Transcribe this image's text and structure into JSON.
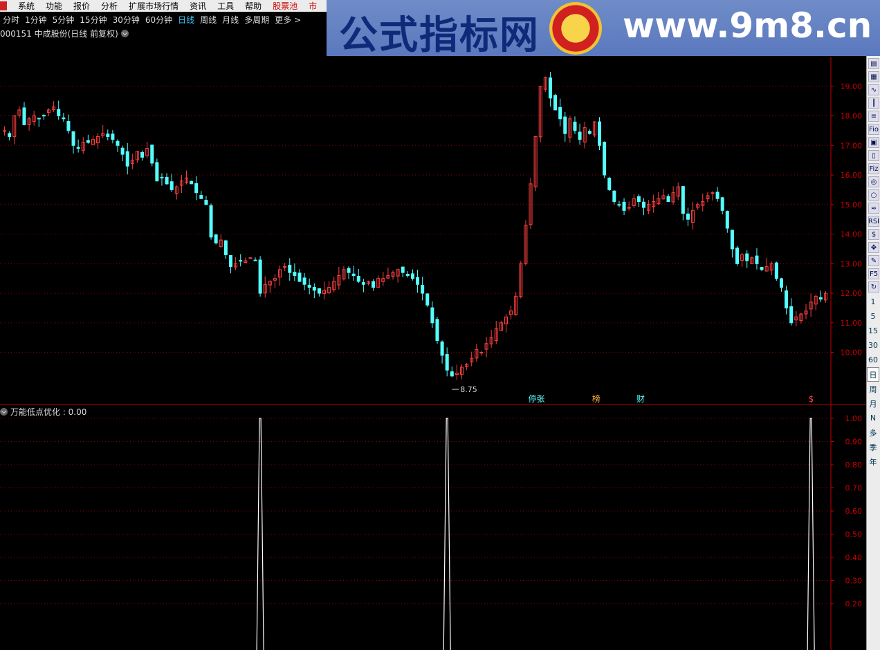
{
  "menu": {
    "items": [
      "系统",
      "功能",
      "报价",
      "分析",
      "扩展市场行情",
      "资讯",
      "工具",
      "帮助"
    ],
    "highlight": "股票池",
    "trailing": "市"
  },
  "periods": {
    "items": [
      "分时",
      "1分钟",
      "5分钟",
      "15分钟",
      "30分钟",
      "60分钟",
      "日线",
      "周线",
      "月线",
      "多周期",
      "更多 >"
    ],
    "active": "日线"
  },
  "stock": {
    "title": "000151 中成股份(日线 前复权)"
  },
  "banner": {
    "site_name": "公式指标网",
    "url": "www.9m8.cn"
  },
  "indicator": {
    "title": "万能低点优化 : 0.00"
  },
  "colors": {
    "up": "#ff4040",
    "down": "#55ffff",
    "grid": "#8b0000",
    "axis": "#cc0000"
  },
  "chart_data": [
    {
      "type": "candlestick",
      "title": "000151 中成股份(日线 前复权)",
      "y_ticks": [
        19.0,
        18.0,
        17.0,
        16.0,
        15.0,
        14.0,
        13.0,
        12.0,
        11.0,
        10.0
      ],
      "y_tick_labels": [
        "19.00",
        "18.00",
        "17.00",
        "16.00",
        "15.00",
        "14.00",
        "13.00",
        "12.00",
        "11.00",
        "10.00"
      ],
      "ylim": [
        8.4,
        20.0
      ],
      "close_series": [
        17.5,
        17.3,
        18.0,
        18.2,
        17.7,
        17.9,
        18.0,
        17.9,
        18.0,
        18.2,
        18.3,
        18.0,
        17.9,
        17.5,
        17.0,
        16.9,
        17.1,
        17.1,
        17.2,
        17.3,
        17.4,
        17.3,
        17.2,
        17.0,
        16.7,
        16.3,
        16.5,
        16.8,
        16.6,
        16.9,
        16.4,
        15.8,
        15.9,
        15.7,
        15.5,
        15.6,
        15.8,
        15.9,
        15.7,
        15.4,
        15.2,
        15.0,
        13.9,
        13.7,
        13.8,
        13.3,
        12.9,
        13.0,
        13.1,
        13.1,
        13.2,
        13.1,
        12.0,
        12.3,
        12.4,
        12.5,
        12.8,
        12.9,
        12.7,
        12.6,
        12.4,
        12.3,
        12.2,
        12.1,
        12.0,
        12.1,
        12.2,
        12.4,
        12.6,
        12.8,
        12.7,
        12.6,
        12.4,
        12.3,
        12.4,
        12.2,
        12.5,
        12.5,
        12.6,
        12.7,
        12.8,
        12.7,
        12.6,
        12.5,
        12.3,
        12.0,
        11.6,
        11.0,
        10.4,
        9.9,
        9.4,
        9.2,
        9.3,
        9.5,
        9.6,
        9.8,
        10.1,
        10.0,
        10.3,
        10.5,
        10.8,
        11.0,
        11.2,
        11.4,
        11.9,
        13.0,
        14.3,
        15.7,
        17.3,
        19.0,
        19.3,
        18.6,
        18.2,
        17.9,
        17.4,
        17.9,
        17.5,
        17.2,
        17.6,
        17.4,
        17.8,
        17.0,
        16.0,
        15.5,
        15.1,
        15.0,
        14.8,
        14.9,
        15.2,
        15.1,
        14.9,
        15.0,
        15.1,
        15.2,
        15.3,
        15.1,
        15.4,
        15.6,
        14.7,
        14.5,
        14.8,
        15.0,
        15.1,
        15.3,
        15.4,
        15.2,
        14.8,
        14.2,
        13.5,
        13.0,
        13.3,
        13.1,
        13.2,
        13.0,
        12.8,
        12.9,
        13.0,
        12.5,
        12.2,
        11.5,
        11.0,
        11.2,
        11.3,
        11.4,
        11.7,
        11.9,
        11.8,
        12.0
      ],
      "annotations": [
        {
          "text": "8.75",
          "value": 8.75,
          "kind": "low"
        },
        {
          "text": "停张",
          "kind": "marker"
        },
        {
          "text": "榜",
          "kind": "marker"
        },
        {
          "text": "财",
          "kind": "marker"
        },
        {
          "text": "$",
          "kind": "marker"
        }
      ]
    },
    {
      "type": "line",
      "title": "万能低点优化",
      "y_ticks": [
        1.0,
        0.9,
        0.8,
        0.7,
        0.6,
        0.5,
        0.4,
        0.3,
        0.2
      ],
      "y_tick_labels": [
        "1.00",
        "0.90",
        "0.80",
        "0.70",
        "0.60",
        "0.50",
        "0.40",
        "0.30",
        "0.20"
      ],
      "ylim": [
        0,
        1.0
      ],
      "spikes_at_index": [
        52,
        90,
        164
      ],
      "spike_value": 1.0,
      "current_value": 0.0
    }
  ],
  "toolbar": {
    "icons": [
      "kline-icon",
      "table-icon",
      "line-chart-icon",
      "bar-chart-icon",
      "list-icon",
      "f10-icon",
      "news-icon",
      "file-icon",
      "fiz-icon",
      "ring-icon",
      "circle-icon",
      "indicator-icon",
      "rsi-icon",
      "money-icon",
      "move-icon",
      "pencil-icon",
      "f5-icon",
      "refresh-icon"
    ],
    "labels": {
      "fio": "Fio",
      "fiz": "Fiz",
      "rsi": "RSI",
      "f5": "F5"
    },
    "periods": [
      "1",
      "5",
      "15",
      "30",
      "60",
      "日",
      "周",
      "月",
      "N",
      "多",
      "季",
      "年"
    ],
    "active_period": "日"
  }
}
